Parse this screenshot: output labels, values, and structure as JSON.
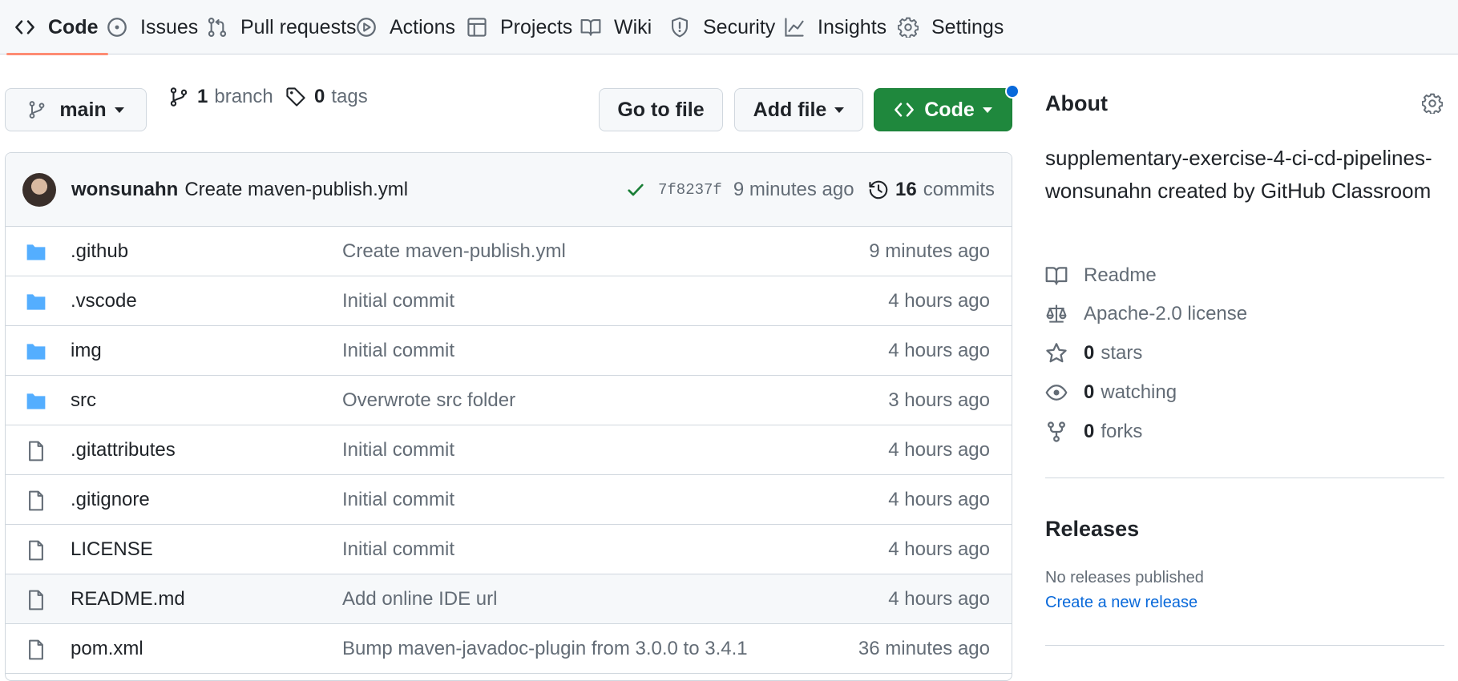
{
  "nav": {
    "tabs": [
      {
        "label": "Code",
        "icon": "code-icon",
        "active": true
      },
      {
        "label": "Issues",
        "icon": "issue-opened-icon"
      },
      {
        "label": "Pull requests",
        "icon": "git-pull-request-icon"
      },
      {
        "label": "Actions",
        "icon": "play-icon"
      },
      {
        "label": "Projects",
        "icon": "table-icon"
      },
      {
        "label": "Wiki",
        "icon": "book-icon"
      },
      {
        "label": "Security",
        "icon": "shield-icon"
      },
      {
        "label": "Insights",
        "icon": "graph-icon"
      },
      {
        "label": "Settings",
        "icon": "gear-icon"
      }
    ],
    "active_underline_color": "#fd8c73"
  },
  "toolbar": {
    "branch_selected": "main",
    "branch_count": "1",
    "branch_label": "branch",
    "tag_count": "0",
    "tag_label": "tags",
    "go_to_file_label": "Go to file",
    "add_file_label": "Add file",
    "code_label": "Code",
    "code_button_color": "#1f883d"
  },
  "latest_commit": {
    "author": "wonsunahn",
    "message": "Create maven-publish.yml",
    "status": "success",
    "sha": "7f8237f",
    "age": "9 minutes ago",
    "commit_count": "16",
    "commit_label": "commits"
  },
  "files": [
    {
      "name": ".github",
      "type": "dir",
      "message": "Create maven-publish.yml",
      "age": "9 minutes ago"
    },
    {
      "name": ".vscode",
      "type": "dir",
      "message": "Initial commit",
      "age": "4 hours ago"
    },
    {
      "name": "img",
      "type": "dir",
      "message": "Initial commit",
      "age": "4 hours ago"
    },
    {
      "name": "src",
      "type": "dir",
      "message": "Overwrote src folder",
      "age": "3 hours ago"
    },
    {
      "name": ".gitattributes",
      "type": "file",
      "message": "Initial commit",
      "age": "4 hours ago"
    },
    {
      "name": ".gitignore",
      "type": "file",
      "message": "Initial commit",
      "age": "4 hours ago"
    },
    {
      "name": "LICENSE",
      "type": "file",
      "message": "Initial commit",
      "age": "4 hours ago"
    },
    {
      "name": "README.md",
      "type": "file",
      "message": "Add online IDE url",
      "age": "4 hours ago"
    },
    {
      "name": "pom.xml",
      "type": "file",
      "message": "Bump maven-javadoc-plugin from 3.0.0 to 3.4.1",
      "age": "36 minutes ago"
    }
  ],
  "about": {
    "heading": "About",
    "description": "supplementary-exercise-4-ci-cd-pipelines-wonsunahn created by GitHub Classroom",
    "readme_label": "Readme",
    "license_label": "Apache-2.0 license",
    "stars_count": "0",
    "stars_label": "stars",
    "watching_count": "0",
    "watching_label": "watching",
    "forks_count": "0",
    "forks_label": "forks"
  },
  "releases": {
    "heading": "Releases",
    "empty_text": "No releases published",
    "create_link": "Create a new release"
  },
  "colors": {
    "link": "#0969da",
    "muted": "#636c76",
    "folder": "#54aeff",
    "success": "#1a7f37"
  }
}
